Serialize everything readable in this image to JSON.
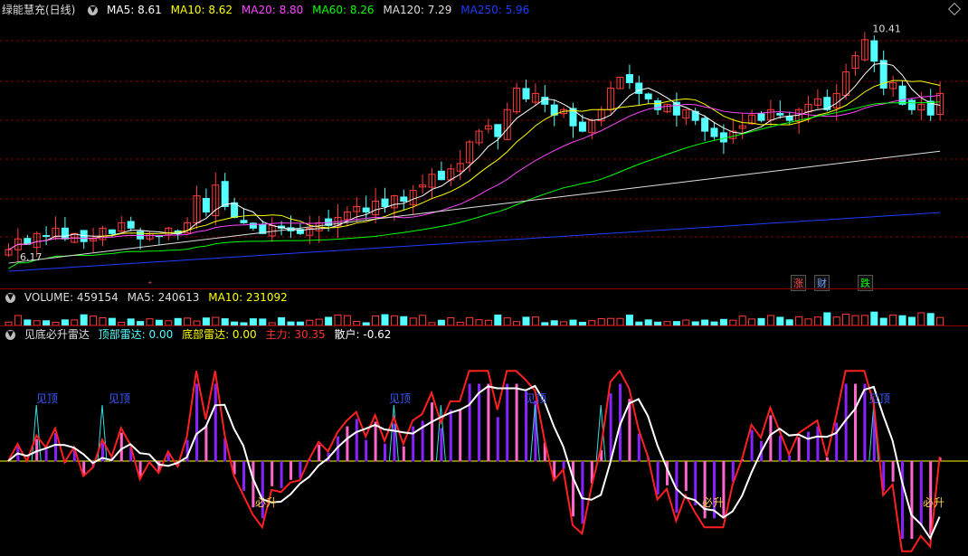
{
  "price_header": {
    "title": "绿能慧充(日线)",
    "ma5": "MA5: 8.61",
    "ma10": "MA10: 8.62",
    "ma20": "MA20: 8.80",
    "ma60": "MA60: 8.26",
    "ma120": "MA120: 7.29",
    "ma250": "MA250: 5.96"
  },
  "vol_header": {
    "volume": "VOLUME: 459154",
    "ma5": "MA5: 240613",
    "ma10": "MA10: 231092"
  },
  "ind_header": {
    "title": "见底必升雷达",
    "top": "顶部雷达: 0.00",
    "bottom": "底部雷达: 0.00",
    "main": "主力: 30.35",
    "retail": "散户: -0.62"
  },
  "annotations": {
    "high": "10.41",
    "low": "6.17",
    "flag_up": "涨",
    "flag_fin": "财",
    "flag_down": "跌",
    "jiandi_labels": [
      "见顶",
      "见顶",
      "见顶",
      "见顶",
      "见顶",
      "见顶"
    ],
    "bisheng_labels": [
      "必升",
      "必升",
      "必升"
    ]
  },
  "colors": {
    "up": "#ff3c3c",
    "down": "#54ffff",
    "ma5": "#ffffff",
    "ma10": "#ffff00",
    "ma20": "#ff44ff",
    "ma60": "#00ff00",
    "ma120": "#dddddd",
    "ma250": "#1e3cff",
    "main_line": "#ff2020",
    "retail_line": "#ffffff"
  },
  "chart_data": [
    {
      "type": "candlestick",
      "closes": [
        6.3,
        6.5,
        6.4,
        6.6,
        6.55,
        6.7,
        6.5,
        6.6,
        6.45,
        6.5,
        6.7,
        6.6,
        6.8,
        6.7,
        6.5,
        6.6,
        6.55,
        6.7,
        6.6,
        6.8,
        7.3,
        7.0,
        7.5,
        7.1,
        6.9,
        6.8,
        6.7,
        6.6,
        6.75,
        6.7,
        6.65,
        6.6,
        6.7,
        6.8,
        6.75,
        6.9,
        7.0,
        7.1,
        7.0,
        7.2,
        7.1,
        7.3,
        7.2,
        7.4,
        7.5,
        7.7,
        7.6,
        7.8,
        7.9,
        8.3,
        8.5,
        8.6,
        8.4,
        8.9,
        9.3,
        9.1,
        9.2,
        9.0,
        8.8,
        8.9,
        8.6,
        8.5,
        8.7,
        8.9,
        9.3,
        9.5,
        9.4,
        9.2,
        9.1,
        8.9,
        9.0,
        8.8,
        8.9,
        8.7,
        8.5,
        8.4,
        8.3,
        8.5,
        8.6,
        8.8,
        8.7,
        8.9,
        8.8,
        8.7,
        8.9,
        9.0,
        9.1,
        8.9,
        9.2,
        9.6,
        9.9,
        10.2,
        9.8,
        9.3,
        9.4,
        9.0,
        8.9,
        9.0,
        8.8,
        9.2
      ],
      "ylim": [
        5.9,
        10.6
      ],
      "high_label": 10.41,
      "low_label": 6.17
    },
    {
      "type": "bar",
      "name": "VOLUME"
    },
    {
      "type": "bar",
      "name": "见底必升雷达",
      "ylim": [
        -100,
        100
      ]
    }
  ]
}
